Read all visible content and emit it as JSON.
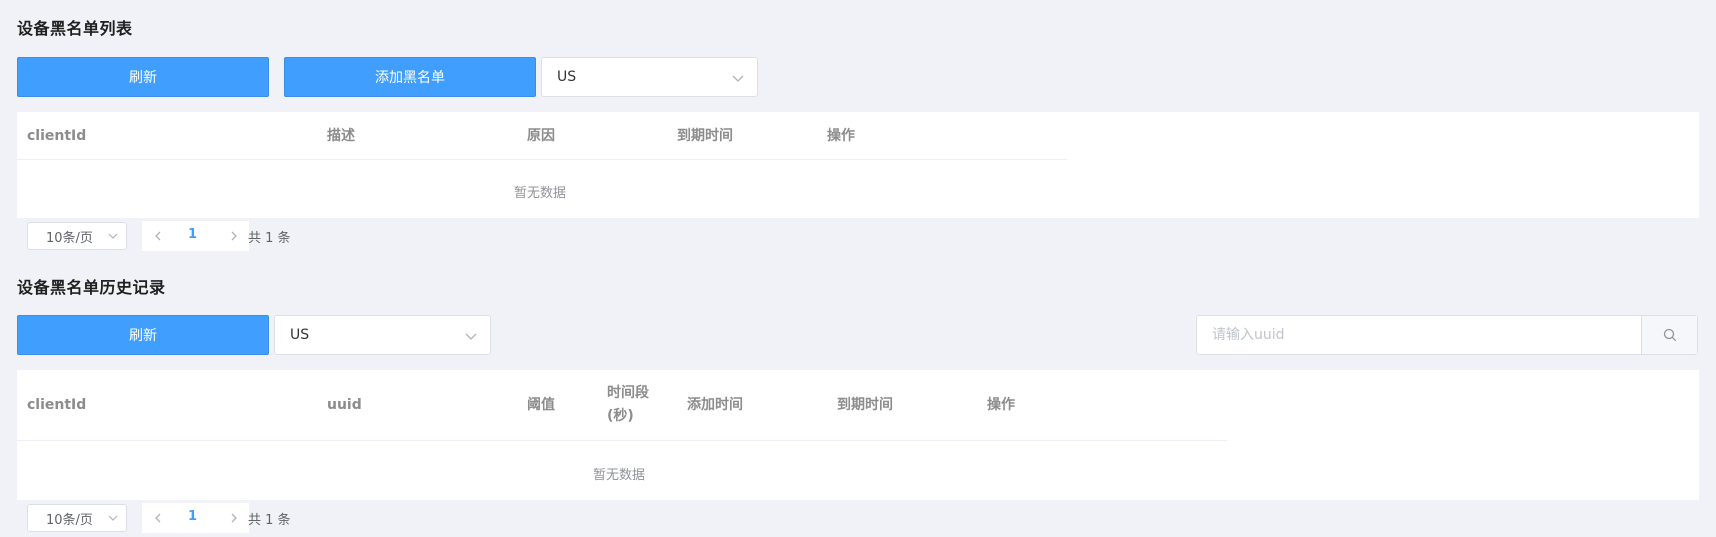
{
  "blacklist": {
    "title": "设备黑名单列表",
    "refresh_label": "刷新",
    "add_label": "添加黑名单",
    "region_select": "US",
    "columns": [
      "clientId",
      "描述",
      "原因",
      "到期时间",
      "操作"
    ],
    "empty_text": "暂无数据",
    "pager": {
      "page_size": "10条/页",
      "current_page": "1",
      "total": "共 1 条"
    }
  },
  "history": {
    "title": "设备黑名单历史记录",
    "refresh_label": "刷新",
    "region_select": "US",
    "search_placeholder": "请输入uuid",
    "columns": [
      "clientId",
      "uuid",
      "阈值",
      "时间段",
      "(秒)",
      "添加时间",
      "到期时间",
      "操作"
    ],
    "empty_text": "暂无数据",
    "pager": {
      "page_size": "10条/页",
      "current_page": "1",
      "total": "共 1 条"
    }
  },
  "icons": {
    "select": "chevron-down-icon",
    "prev": "chevron-left-icon",
    "next": "chevron-right-icon",
    "search": "search-icon"
  },
  "colors": {
    "primary": "#409eff",
    "background": "#f0f2f7",
    "header_text": "#8c8c8c"
  }
}
